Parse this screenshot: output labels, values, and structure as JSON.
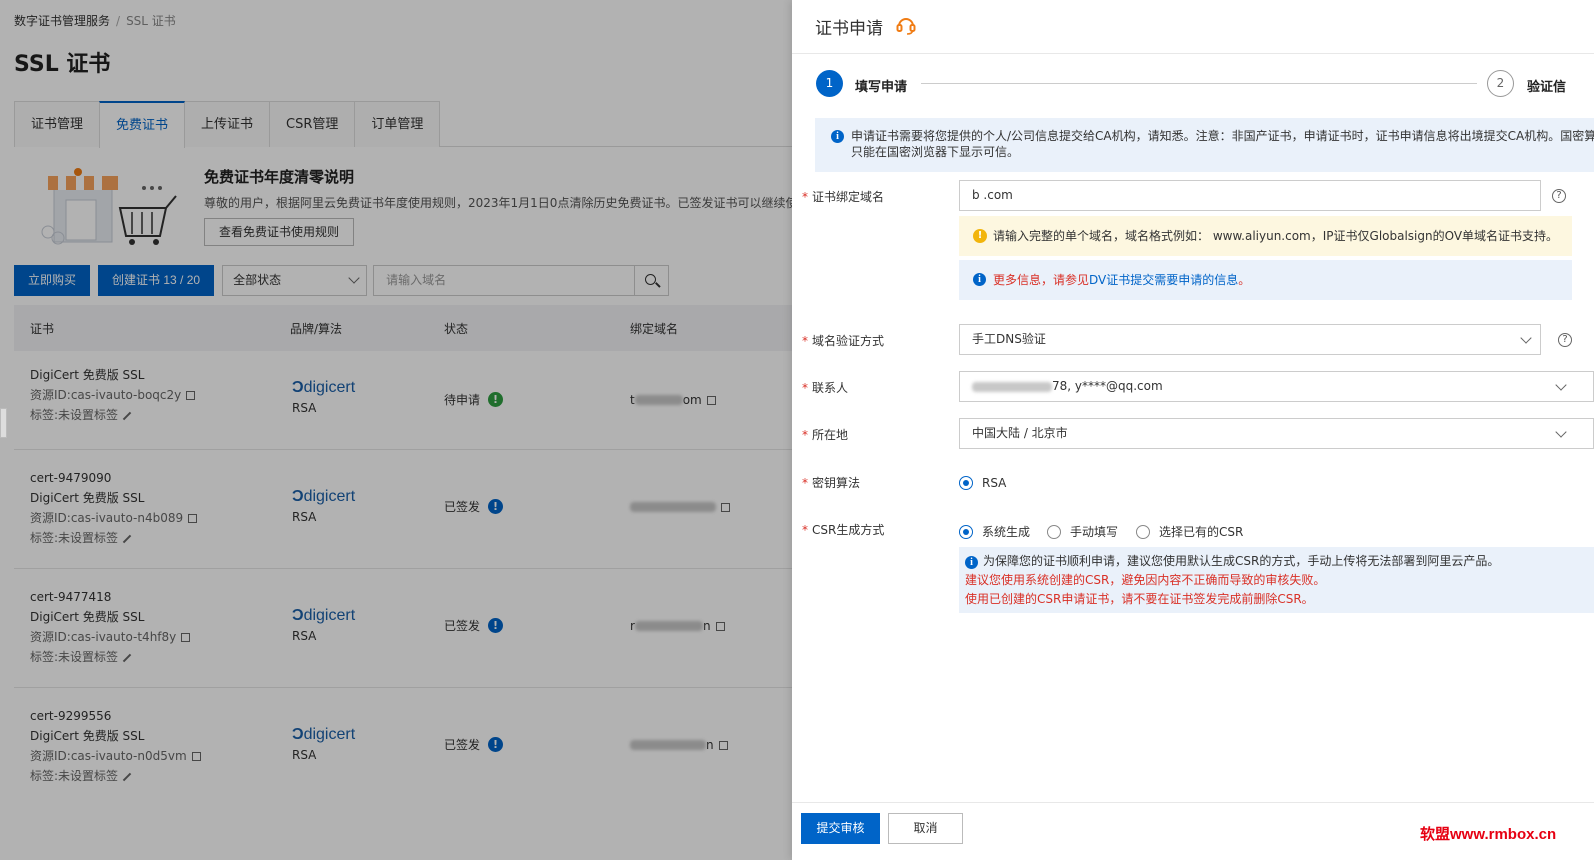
{
  "console": {
    "breadcrumb": [
      "数字证书管理服务",
      "SSL 证书"
    ],
    "title": "SSL 证书",
    "tabs": [
      "证书管理",
      "免费证书",
      "上传证书",
      "CSR管理",
      "订单管理"
    ],
    "active_tab": "免费证书",
    "notice": {
      "title": "免费证书年度清零说明",
      "text": "尊敬的用户，根据阿里云免费证书年度使用规则，2023年1月1日0点清除历史免费证书。已签发证书可以继续使用",
      "button": "查看免费证书使用规则"
    },
    "toolbar": {
      "buy_button": "立即购买",
      "create_button": "创建证书 13 / 20",
      "status_select": "全部状态",
      "search_placeholder": "请输入域名"
    },
    "table": {
      "headers": [
        "证书",
        "品牌/算法",
        "状态",
        "绑定域名"
      ],
      "rows": [
        {
          "id": "",
          "name": "DigiCert 免费版 SSL",
          "resource": "资源ID:cas-ivauto-boqc2y",
          "tag": "标签:未设置标签",
          "brand": "digicert",
          "alg": "RSA",
          "status": "待申请",
          "status_color": "#2e9e41",
          "domain_suffix": "om"
        },
        {
          "id": "cert-9479090",
          "name": "DigiCert 免费版 SSL",
          "resource": "资源ID:cas-ivauto-n4b089",
          "tag": "标签:未设置标签",
          "brand": "digicert",
          "alg": "RSA",
          "status": "已签发",
          "status_color": "#0064c8",
          "domain_suffix": ""
        },
        {
          "id": "cert-9477418",
          "name": "DigiCert 免费版 SSL",
          "resource": "资源ID:cas-ivauto-t4hf8y",
          "tag": "标签:未设置标签",
          "brand": "digicert",
          "alg": "RSA",
          "status": "已签发",
          "status_color": "#0064c8",
          "domain_suffix": "n"
        },
        {
          "id": "cert-9299556",
          "name": "DigiCert 免费版 SSL",
          "resource": "资源ID:cas-ivauto-n0d5vm",
          "tag": "标签:未设置标签",
          "brand": "digicert",
          "alg": "RSA",
          "status": "已签发",
          "status_color": "#0064c8",
          "domain_suffix": "n"
        }
      ]
    }
  },
  "drawer": {
    "title": "证书申请",
    "steps": [
      {
        "num": "1",
        "label": "填写申请"
      },
      {
        "num": "2",
        "label": "验证信"
      }
    ],
    "info_banner": [
      "申请证书需要将您提供的个人/公司信息提交给CA机构，请知悉。注意：非国产证书，申请证书时，证书申请信息将出境提交CA机构。国密算",
      "只能在国密浏览器下显示可信。"
    ],
    "fields": {
      "domain": {
        "label": "证书绑定域名",
        "value": "b        .com"
      },
      "domain_warn": "请输入完整的单个域名，域名格式例如： www.aliyun.com，IP证书仅Globalsign的OV单域名证书支持。",
      "domain_more_red": "更多信息，请参见",
      "domain_more_link": "DV证书提交需要申请的信息",
      "domain_more_end": "。",
      "verify": {
        "label": "域名验证方式",
        "value": "手工DNS验证"
      },
      "contact": {
        "label": "联系人",
        "value": "78, y****@qq.com"
      },
      "location": {
        "label": "所在地",
        "value": "中国大陆 / 北京市"
      },
      "algorithm": {
        "label": "密钥算法",
        "option": "RSA"
      },
      "csr": {
        "label": "CSR生成方式",
        "options": [
          "系统生成",
          "手动填写",
          "选择已有的CSR"
        ]
      },
      "csr_info": "为保障您的证书顺利申请，建议您使用默认生成CSR的方式，手动上传将无法部署到阿里云产品。",
      "csr_red_1": "建议您使用系统创建的CSR，避免因内容不正确而导致的审核失败。",
      "csr_red_2": "使用已创建的CSR申请证书，请不要在证书签发完成前删除CSR。"
    },
    "submit": "提交审核",
    "cancel": "取消"
  },
  "watermark": "软盟www.rmbox.cn",
  "colors": {
    "primary": "#0064c8",
    "danger": "#d93026",
    "warning": "#f2b50c",
    "orange_icon": "#f07c14"
  }
}
